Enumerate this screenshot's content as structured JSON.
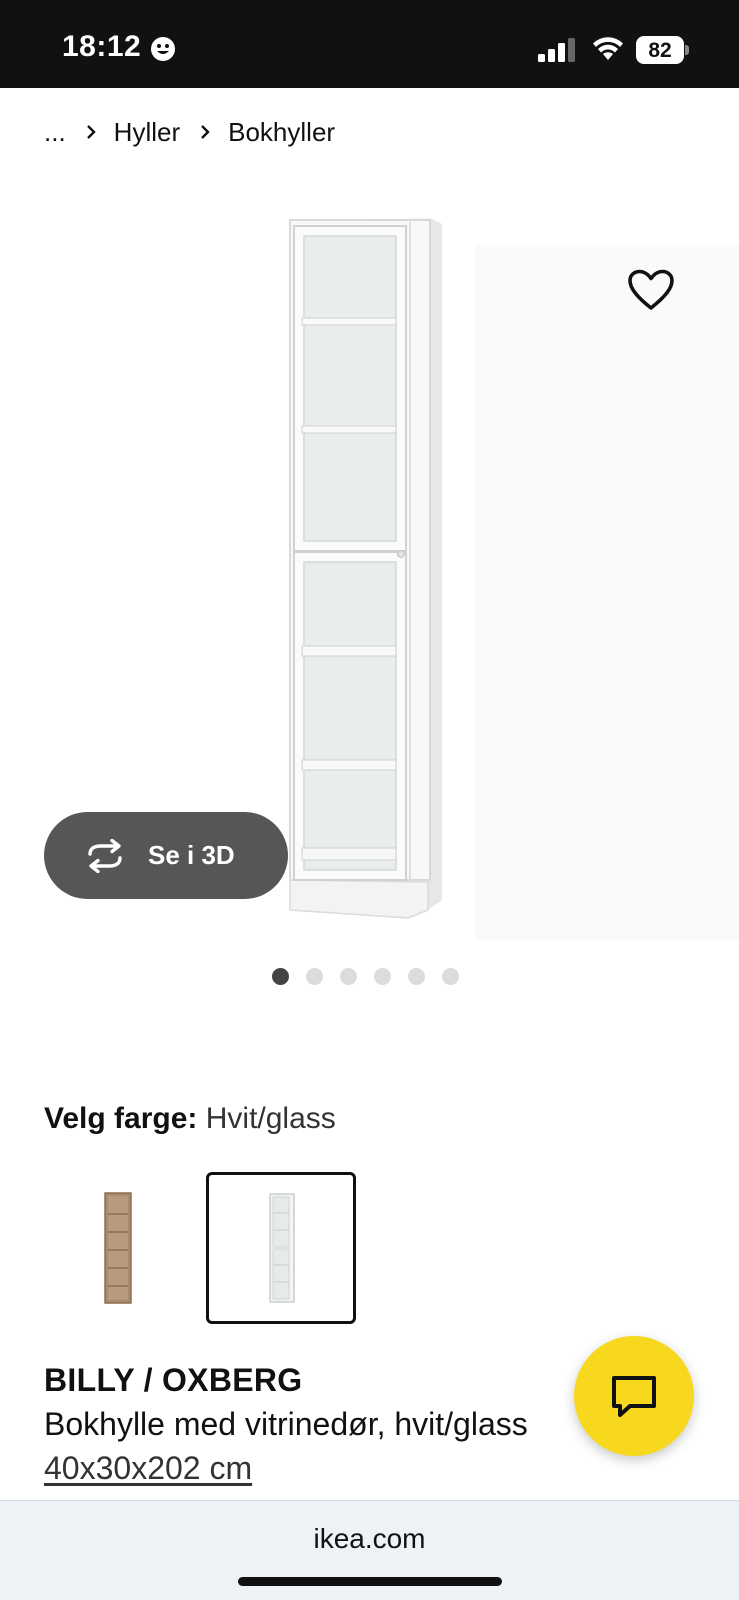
{
  "status_bar": {
    "time": "18:12",
    "battery": "82",
    "icons": [
      "smiley-icon",
      "signal-icon",
      "wifi-icon",
      "battery-icon"
    ]
  },
  "breadcrumb": {
    "items": [
      "...",
      "Hyller",
      "Bokhyller"
    ]
  },
  "gallery": {
    "view_3d_label": "Se i 3D",
    "dot_count": 6,
    "active_dot": 1
  },
  "color_select": {
    "label": "Velg farge:",
    "value": "Hvit/glass",
    "swatches": [
      {
        "name": "brown",
        "selected": false
      },
      {
        "name": "white-glass",
        "selected": true
      }
    ]
  },
  "product": {
    "name": "BILLY / OXBERG",
    "description": "Bokhylle med vitrinedør, hvit/glass",
    "size": "40x30x202 cm"
  },
  "browser": {
    "url": "ikea.com"
  },
  "colors": {
    "chat_button": "#f8d81f",
    "status_bar": "#111111"
  }
}
